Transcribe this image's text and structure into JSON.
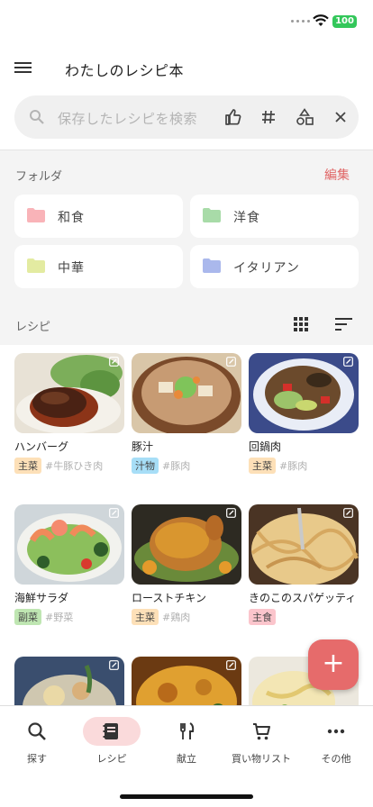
{
  "status": {
    "battery": "100"
  },
  "appbar": {
    "title": "わたしのレシピ本"
  },
  "search": {
    "placeholder": "保存したレシピを検索"
  },
  "folders": {
    "title": "フォルダ",
    "edit_label": "編集",
    "items": [
      {
        "label": "和食",
        "color": "#f9b3b8"
      },
      {
        "label": "洋食",
        "color": "#a8dba8"
      },
      {
        "label": "中華",
        "color": "#e3eba1"
      },
      {
        "label": "イタリアン",
        "color": "#aab8ec"
      }
    ]
  },
  "recipes": {
    "title": "レシピ",
    "items": [
      {
        "name": "ハンバーグ",
        "category": "主菜",
        "category_color": "#fde0b8",
        "tag": "#牛豚ひき肉",
        "food_icon": "hamburg-steak-photo"
      },
      {
        "name": "豚汁",
        "category": "汁物",
        "category_color": "#a7def7",
        "tag": "#豚肉",
        "food_icon": "tonjiru-photo"
      },
      {
        "name": "回鍋肉",
        "category": "主菜",
        "category_color": "#fde0b8",
        "tag": "#豚肉",
        "food_icon": "hoikoro-photo"
      },
      {
        "name": "海鮮サラダ",
        "category": "副菜",
        "category_color": "#bfe6b2",
        "tag": "#野菜",
        "food_icon": "seafood-salad-photo"
      },
      {
        "name": "ローストチキン",
        "category": "主菜",
        "category_color": "#fde0b8",
        "tag": "#鶏肉",
        "food_icon": "roast-chicken-photo"
      },
      {
        "name": "きのこのスパゲッティ",
        "category": "主食",
        "category_color": "#fbc5cc",
        "tag": "",
        "food_icon": "mushroom-spaghetti-photo"
      },
      {
        "name": "",
        "category": "",
        "category_color": "",
        "tag": "",
        "food_icon": "nimono-photo"
      },
      {
        "name": "",
        "category": "",
        "category_color": "",
        "tag": "",
        "food_icon": "sweet-sour-pork-photo"
      },
      {
        "name": "",
        "category": "",
        "category_color": "",
        "tag": "",
        "food_icon": "pasta-salad-photo"
      }
    ]
  },
  "nav": {
    "items": [
      {
        "label": "探す",
        "icon": "search-icon"
      },
      {
        "label": "レシピ",
        "icon": "recipe-book-icon",
        "active": true
      },
      {
        "label": "献立",
        "icon": "fork-knife-icon"
      },
      {
        "label": "買い物リスト",
        "icon": "cart-icon"
      },
      {
        "label": "その他",
        "icon": "more-icon"
      }
    ]
  },
  "fab": {
    "label": "+"
  },
  "colors": {
    "accent": "#e66b6b",
    "active_pill": "#fadadb"
  }
}
